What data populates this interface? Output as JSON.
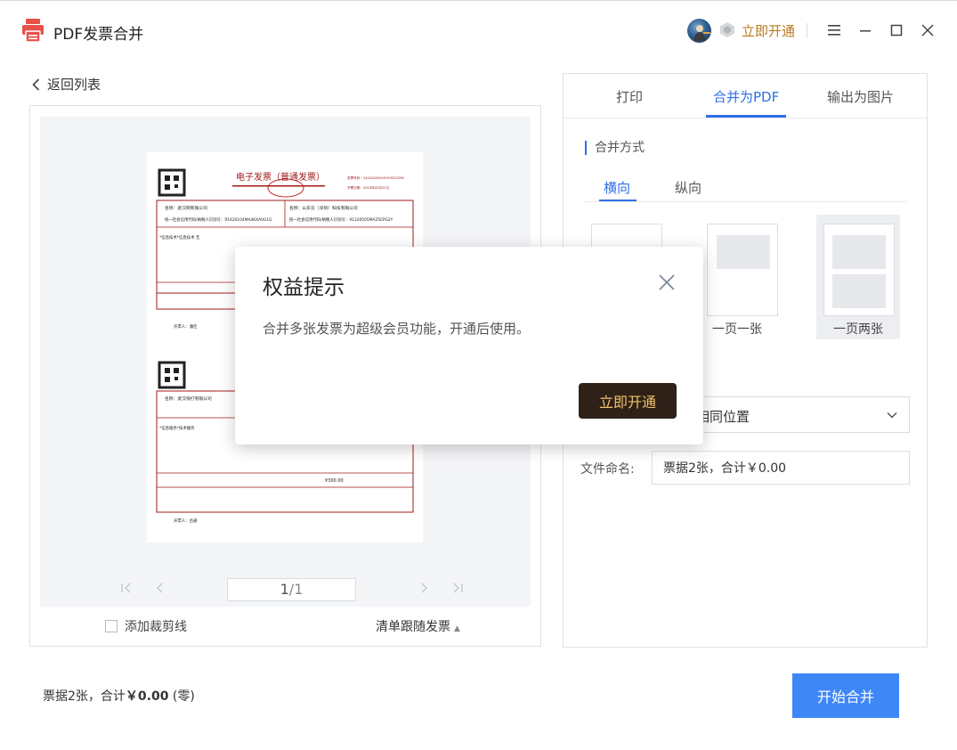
{
  "app": {
    "title": "PDF发票合并"
  },
  "titlebar": {
    "vip_link": "立即开通",
    "vip_color": "#b8791e",
    "brand_color": "#e8504a"
  },
  "nav": {
    "back_label": "返回列表"
  },
  "preview": {
    "page_current": "1",
    "page_total": "/1",
    "crop_label": "添加裁剪线",
    "list_follow_label": "清单跟随发票",
    "invoice": {
      "title": "电子发票（普通发票）",
      "number_label": "发票号码：24422000000193052336",
      "date_label": "开票日期：2024年05月22日",
      "buyer_1": "名称：武汉网有限公司",
      "buyer_2": "名称：武汉快打有限公司",
      "seller_1": "名称：山东云（深圳）科技有限公司",
      "tax_id_1": "统一社会信用代码/纳税人识别号：91420104MA4KXA0G1G",
      "tax_id_2": "统一社会信用代码/纳税人识别号：91320505MA25EPG2Y",
      "item_1": "*信息技术*信息技术 无",
      "item_2": "*信息服务*技术服务",
      "total_1": "¥29.90",
      "total_2": "¥300.00",
      "issuer": "开票人：潘佳",
      "issuer_2": "开票人：吕通"
    }
  },
  "tabs": [
    {
      "label": "打印"
    },
    {
      "label": "合并为PDF"
    },
    {
      "label": "输出为图片"
    }
  ],
  "merge": {
    "section_title": "合并方式",
    "subtabs": [
      {
        "label": "横向"
      },
      {
        "label": "纵向"
      }
    ],
    "layouts": [
      {
        "label": ""
      },
      {
        "label": "一页一张"
      },
      {
        "label": "一页两张"
      }
    ],
    "position_value": "相同位置",
    "filename_label": "文件命名:",
    "filename_value": "票据2张，合计￥0.00"
  },
  "footer": {
    "summary_prefix": "票据2张，合计",
    "summary_amount": "￥0.00",
    "summary_suffix": "(零)",
    "start_button": "开始合并",
    "accent_color": "#3f86f7"
  },
  "modal": {
    "title": "权益提示",
    "message": "合并多张发票为超级会员功能，开通后使用。",
    "button": "立即开通"
  }
}
